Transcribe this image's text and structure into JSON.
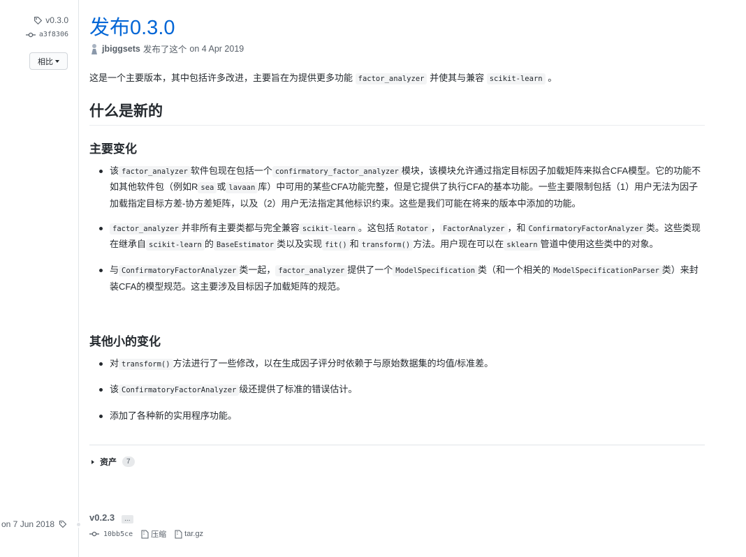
{
  "sidebar": {
    "tag": "v0.3.0",
    "commit": "a3f8306",
    "compare_label": "相比"
  },
  "release": {
    "title": "发布0.3.0",
    "author": "jbiggsets",
    "published_text": "发布了这个",
    "date": "on 4 Apr 2019",
    "intro": {
      "p1": "这是一个主要版本，其中包括许多改进，主要旨在为提供更多功能",
      "c1": "factor_analyzer",
      "p2": "并使其与兼容",
      "c2": "scikit-learn",
      "p3": "。"
    },
    "whats_new": "什么是新的",
    "major_heading": "主要变化",
    "major": [
      {
        "t1": "该",
        "c1": "factor_analyzer",
        "t2": "软件包现在包括一个",
        "c2": "confirmatory_factor_analyzer",
        "t3": "模块，该模块允许通过指定目标因子加载矩阵来拟合CFA模型。它的功能不如其他软件包（例如R",
        "c3": "sea",
        "t4": "或",
        "c4": "lavaan",
        "t5": "库）中可用的某些CFA功能完整，但是它提供了执行CFA的基本功能。一些主要限制包括（1）用户无法为因子加载指定目标方差-协方差矩阵，以及（2）用户无法指定其他标识约束。这些是我们可能在将来的版本中添加的功能。"
      },
      {
        "c1": "factor_analyzer",
        "t1": "并非所有主要类都与完全兼容",
        "c2": "scikit-learn",
        "t2": "。这包括",
        "c3": "Rotator",
        "t3": "，",
        "c4": "FactorAnalyzer",
        "t4": "，和",
        "c5": "ConfirmatoryFactorAnalyzer",
        "t5": "类。这些类现在继承自",
        "c6": "scikit-learn",
        "t6": "的",
        "c7": "BaseEstimator",
        "t7": "类以及实现",
        "c8": "fit()",
        "t8": "和",
        "c9": "transform()",
        "t9": "方法。用户现在可以在",
        "c10": "sklearn",
        "t10": "管道中使用这些类中的对象。"
      },
      {
        "t1": "与",
        "c1": "ConfirmatoryFactorAnalyzer",
        "t2": "类一起，",
        "c2": "factor_analyzer",
        "t3": "提供了一个",
        "c3": "ModelSpecification",
        "t4": "类（和一个相关的",
        "c4": "ModelSpecificationParser",
        "t5": "类）来封装CFA的模型规范。这主要涉及目标因子加载矩阵的规范。"
      }
    ],
    "minor_heading": "其他小的变化",
    "minor": [
      {
        "t1": "对",
        "c1": "transform()",
        "t2": "方法进行了一些修改，以在生成因子评分时依赖于与原始数据集的均值/标准差。"
      },
      {
        "t1": "该",
        "c1": "ConfirmatoryFactorAnalyzer",
        "t2": "级还提供了标准的错误估计。"
      },
      {
        "t1": "添加了各种新的实用程序功能。"
      }
    ],
    "assets_label": "资产",
    "assets_count": "7"
  },
  "previous_release": {
    "date": "on 7 Jun 2018",
    "tag": "v0.2.3",
    "ellipsis": "...",
    "commit": "10bb5ce",
    "zip_label": "压缩",
    "targz_label": "tar.gz"
  },
  "colors": {
    "link": "#0366d6",
    "text": "#24292e",
    "muted": "#586069",
    "border": "#e1e4e8"
  },
  "icons": [
    "tag-icon",
    "commit-icon",
    "caret-down-icon",
    "avatar",
    "zip-icon",
    "file-icon",
    "triangle-right-icon"
  ]
}
